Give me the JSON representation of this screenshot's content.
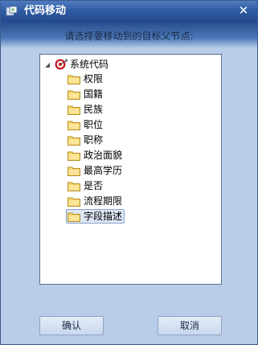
{
  "window": {
    "title": "代码移动",
    "close_glyph": "✕"
  },
  "instruction": "请选择要移动到的目标父节点:",
  "tree": {
    "root_label": "系统代码",
    "expander_glyph": "◢",
    "items": [
      {
        "label": "权限"
      },
      {
        "label": "国籍"
      },
      {
        "label": "民族"
      },
      {
        "label": "职位"
      },
      {
        "label": "职称"
      },
      {
        "label": "政治面貌"
      },
      {
        "label": "最高学历"
      },
      {
        "label": "是否"
      },
      {
        "label": "流程期限"
      },
      {
        "label": "字段描述",
        "selected": true
      }
    ]
  },
  "buttons": {
    "confirm_label": "确认",
    "cancel_label": "取消"
  },
  "icons": {
    "app": "app-icon",
    "close": "close-icon",
    "root": "target-icon",
    "folder": "folder-icon"
  },
  "colors": {
    "titlebar": "#2e5ba3",
    "window_bg": "#b9cce8",
    "selection": "#dde6f5",
    "folder": "#f2c94c"
  }
}
